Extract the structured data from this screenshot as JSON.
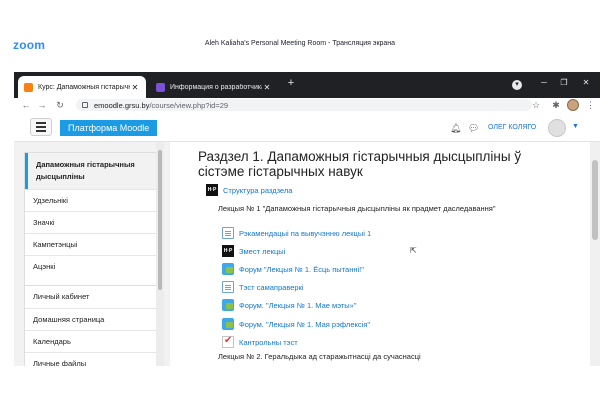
{
  "zoom": {
    "logo": "zoom",
    "title": "Aleh Kaliaha's Personal Meeting Room - Трансляция экрана"
  },
  "browser": {
    "tabs": [
      {
        "label": "Курс: Дапаможныя гістарычныя",
        "active": true
      },
      {
        "label": "Информация о разработчиках",
        "active": false
      }
    ],
    "url_host": "emoodle.grsu.by",
    "url_path": "/course/view.php?id=29"
  },
  "moodle": {
    "brand": "Платформа Moodle",
    "user_name": "ОЛЕГ КОЛЯГО",
    "nav_course": [
      "Дапаможныя гістарычныя дысцыпліны",
      "Удзельнікі",
      "Значкі",
      "Кампетэнцыі",
      "Ацэнкі"
    ],
    "nav_personal": [
      "Личный кабинет",
      "Домашняя страница",
      "Календарь",
      "Личные файлы"
    ]
  },
  "section": {
    "title": "Раздзел 1. Дапаможныя гістарычныя дысцыпліны ў сістэме гістарычных навук",
    "structure_link": "Структура раздзела",
    "lecture1": "Лекцыя № 1 \"Дапаможныя гістарычныя дысцыпліны як прадмет даследавання\"",
    "activities": [
      {
        "icon": "file-icon",
        "label": "Рэкамендацыі па вывучэнню лекцыі 1"
      },
      {
        "icon": "hp-icon",
        "label": "Змест лекцыі"
      },
      {
        "icon": "forum-icon",
        "label": "Форум \"Лекцыя № 1. Ёсць пытанні!\""
      },
      {
        "icon": "file-icon",
        "label": "Тэст самаправеркі"
      },
      {
        "icon": "forum-icon",
        "label": "Форум. \"Лекцыя № 1. Мае мэты»\""
      },
      {
        "icon": "forum-icon",
        "label": "Форум. \"Лекцыя № 1. Мая рэфлексія\""
      },
      {
        "icon": "quiz-icon",
        "label": "Кантрольны тэст"
      }
    ],
    "lecture2": "Лекцыя № 2. Геральдыка ад старажытнасці да сучаснасці"
  }
}
